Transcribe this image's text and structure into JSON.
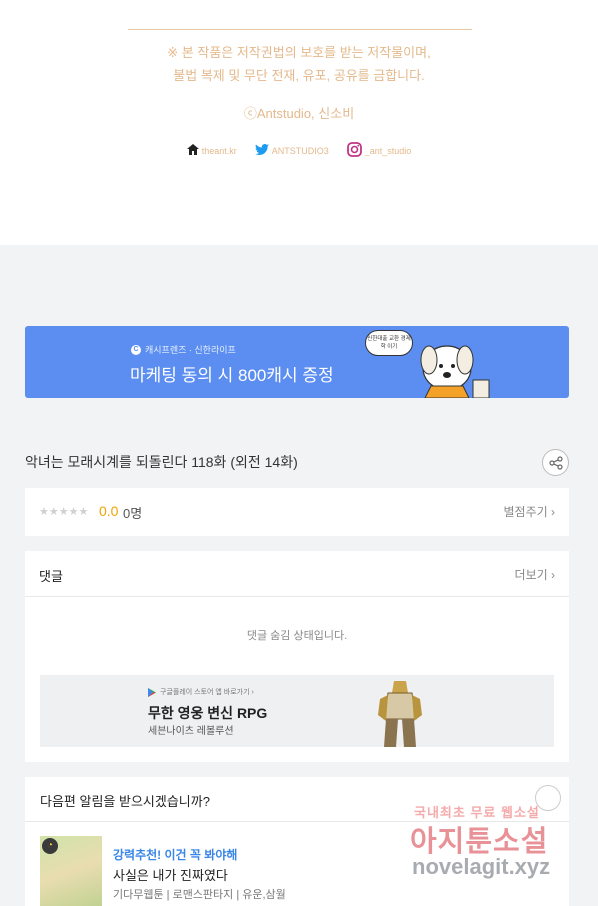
{
  "copyright": {
    "notice_line1": "※ 본 작품은 저작권법의 보호를 받는 저작물이며,",
    "notice_line2": "불법 복제 및 무단 전재, 유포, 공유를 금합니다.",
    "credit": "ⓒAntstudio, 신소비",
    "socials": [
      {
        "icon": "home-icon",
        "label": "theant.kr"
      },
      {
        "icon": "twitter-icon",
        "label": "ANTSTUDIO3"
      },
      {
        "icon": "instagram-icon",
        "label": "_ant_studio"
      }
    ],
    "accent": "#e4b98c"
  },
  "banner": {
    "sub": "캐시프렌즈 · 신한라이프",
    "main": "마케팅 동의 시 800캐시 증정",
    "bubble": "신한대출 교환 경제학 이기",
    "bg": "#5b8ef0"
  },
  "episode": {
    "title": "악녀는 모래시계를 되돌린다 118화 (외전 14화)"
  },
  "rating": {
    "stars": "★★★★★",
    "score": "0.0",
    "count": "0명",
    "action": "별점주기"
  },
  "comments": {
    "title": "댓글",
    "more": "더보기",
    "hidden_text": "댓글 숨김 상태입니다.",
    "ad": {
      "store": "구글플레이 스토어 앱 바로가기 ›",
      "title": "무한 영웅 변신 RPG",
      "sub": "세븐나이츠 레볼루션"
    }
  },
  "next": {
    "question": "다음편 알림을 받으시겠습니까?",
    "recommend": "강력추천! 이건 꼭 봐야해",
    "book_title": "사실은 내가 진짜였다",
    "meta": "기다무웹툰 | 로맨스판타지 | 유운,삼월"
  },
  "watermark": {
    "line1": "국내최초 무료 웹소설",
    "line2": "아지툰소설",
    "line3": "novelagit.xyz"
  }
}
